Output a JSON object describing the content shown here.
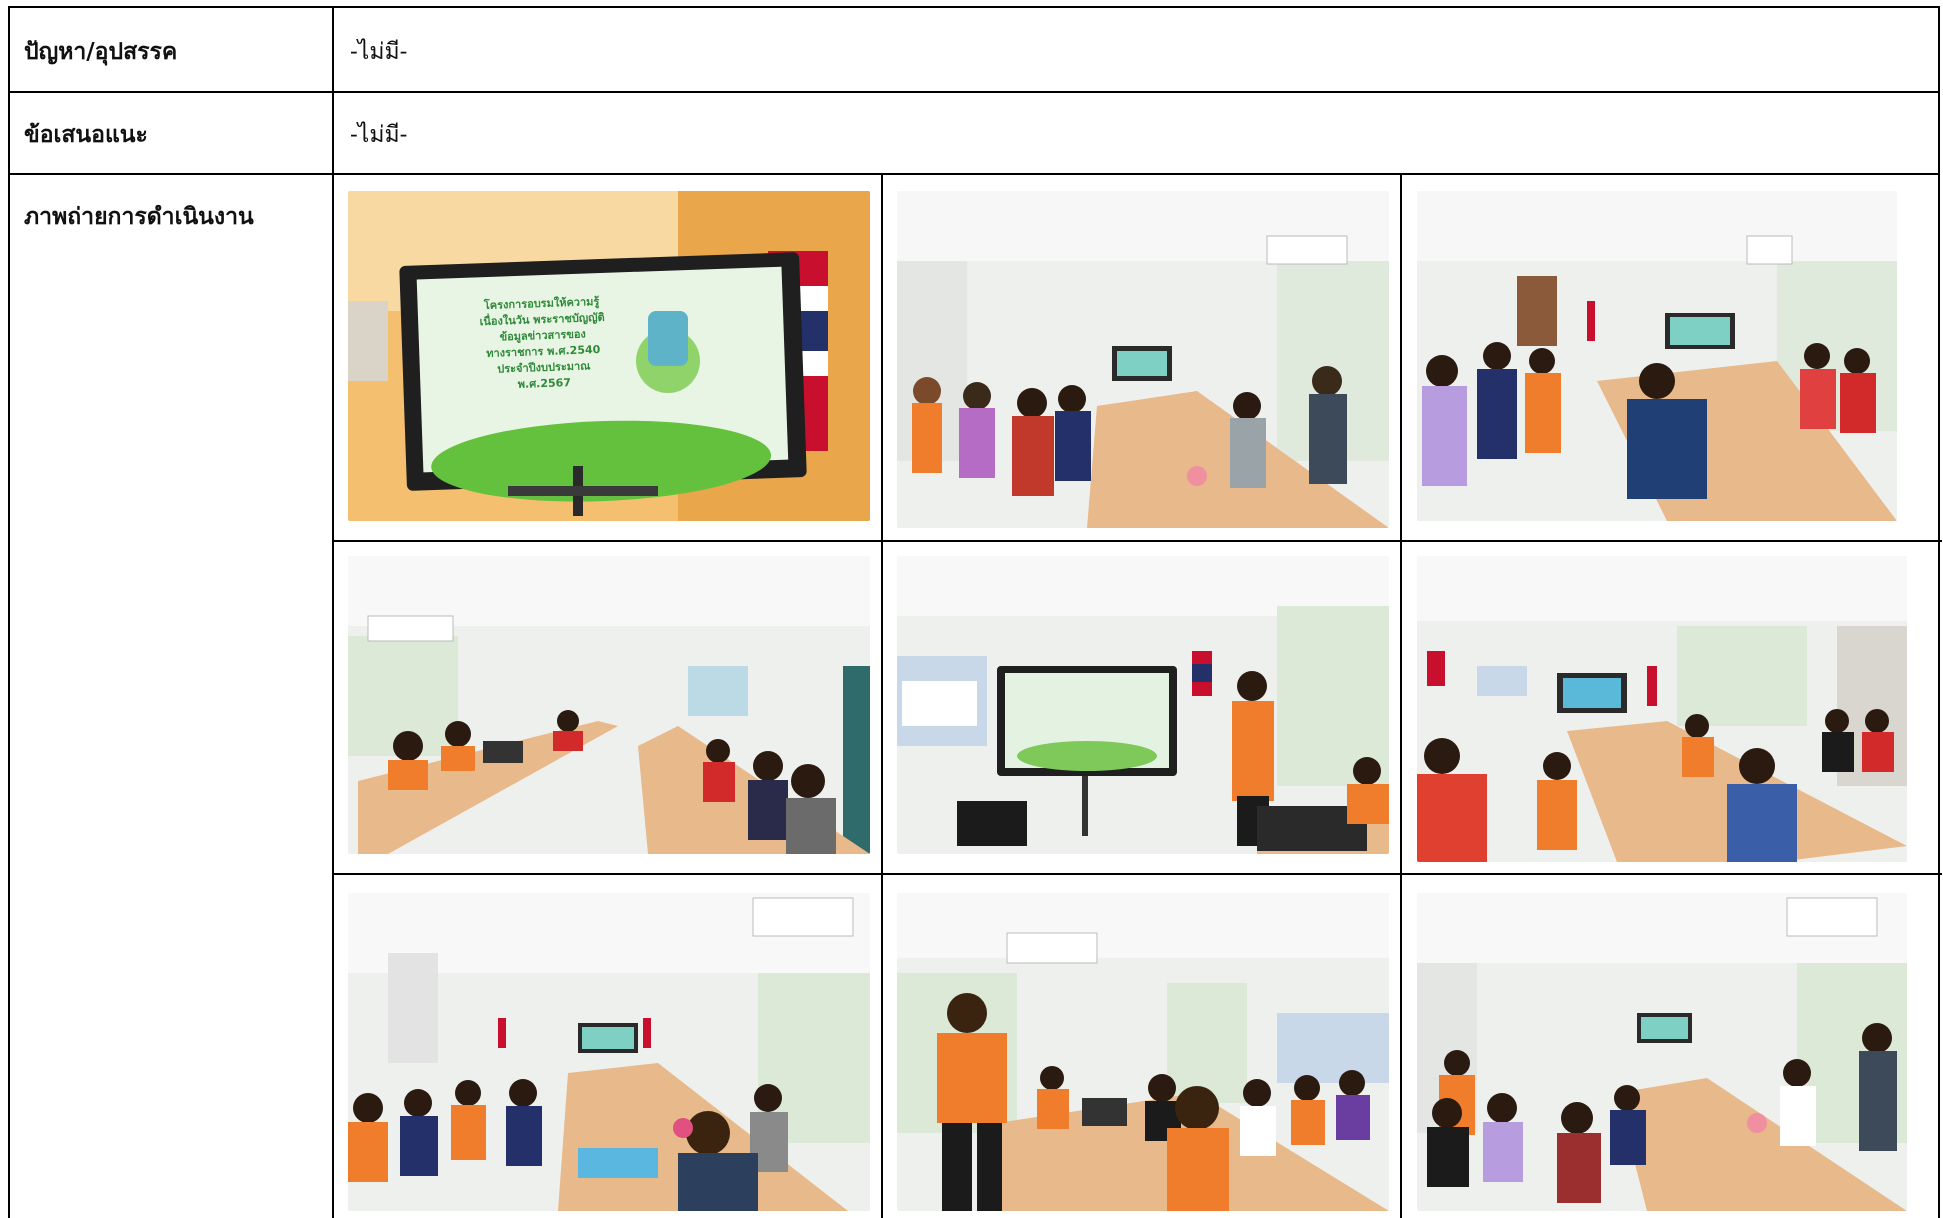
{
  "rows": [
    {
      "label": "ปัญหา/อุปสรรค",
      "value": "-ไม่มี-"
    },
    {
      "label": "ข้อเสนอแนะ",
      "value": "-ไม่มี-"
    },
    {
      "label": "ภาพถ่ายการดำเนินงาน"
    }
  ],
  "slide_text": {
    "line1": "โครงการอบรมให้ความรู้",
    "line2": "เนื่องในวัน พระราชบัญญัติ",
    "line3": "ข้อมูลข่าวสารของ",
    "line4": "ทางราชการ พ.ศ.2540",
    "line5": "ประจำปีงบประมาณ",
    "line6": "พ.ศ.2567"
  },
  "colors": {
    "wall": "#eef0ee",
    "table": "#e8b98a",
    "shirt": "#f07d2c",
    "screen": "#2b2b2b",
    "slide": "#e9f5e4"
  }
}
